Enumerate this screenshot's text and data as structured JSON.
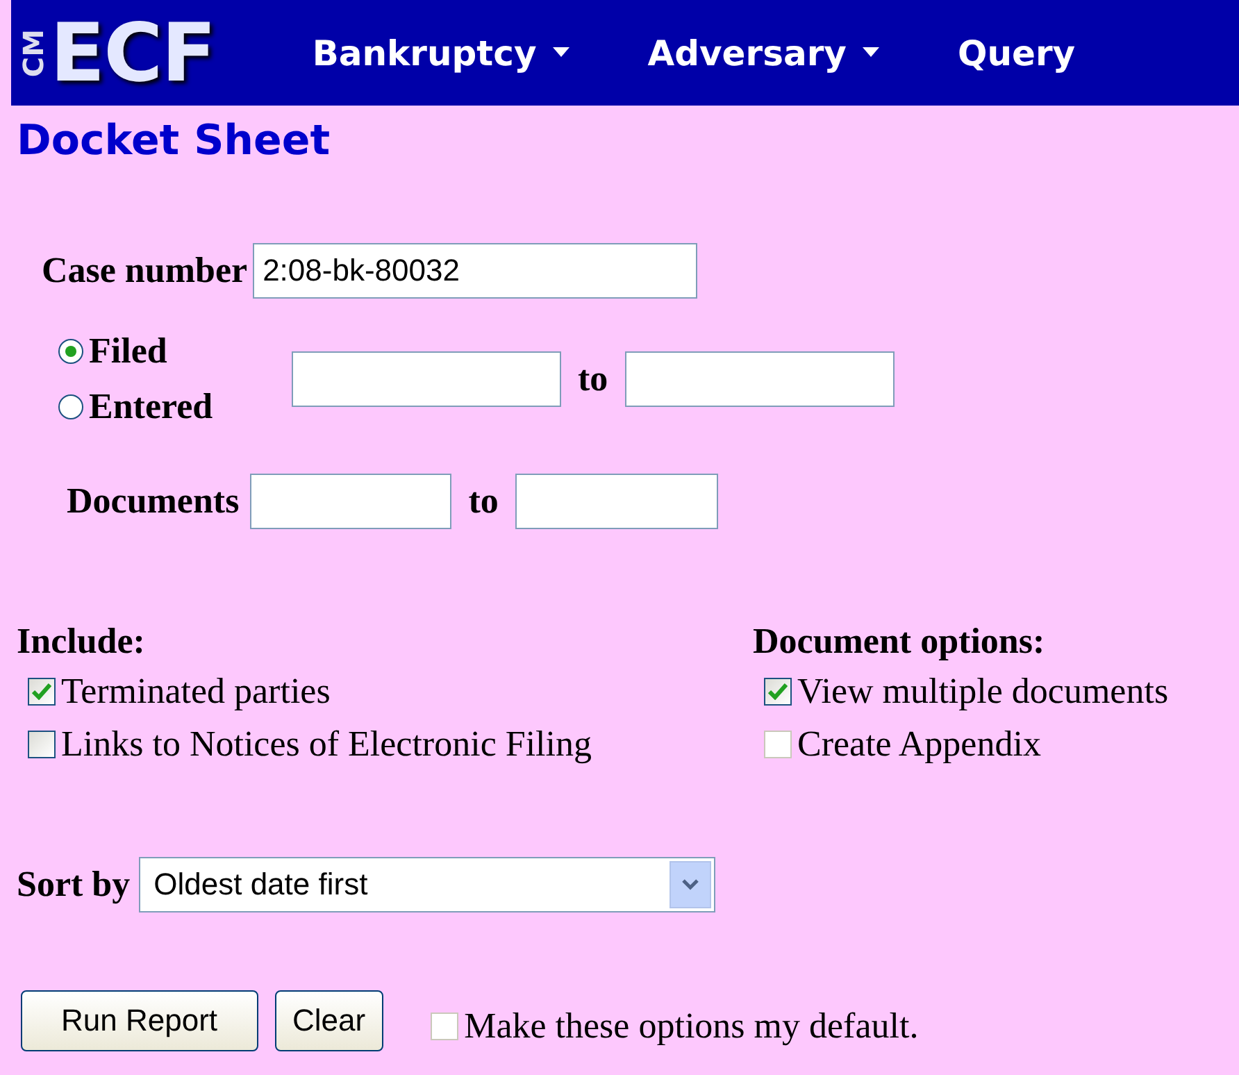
{
  "header": {
    "logo_small": "CM",
    "logo": "ECF",
    "menu": [
      {
        "label": "Bankruptcy",
        "dropdown": true
      },
      {
        "label": "Adversary",
        "dropdown": true
      },
      {
        "label": "Query",
        "dropdown": false
      }
    ]
  },
  "title": "Docket Sheet",
  "case_number": {
    "label": "Case number",
    "value": "2:08-bk-80032"
  },
  "date_type": [
    {
      "label": "Filed",
      "selected": true
    },
    {
      "label": "Entered",
      "selected": false
    }
  ],
  "date_range_separator": "to",
  "documents": {
    "label": "Documents",
    "separator": "to"
  },
  "include": {
    "heading": "Include:",
    "options": [
      {
        "label": "Terminated parties",
        "checked": true,
        "disabled": false
      },
      {
        "label": "Links to Notices of Electronic Filing",
        "checked": false,
        "disabled": false
      }
    ]
  },
  "document_options": {
    "heading": "Document options:",
    "options": [
      {
        "label": "View multiple documents",
        "checked": true,
        "disabled": false
      },
      {
        "label": "Create Appendix",
        "checked": false,
        "disabled": true
      }
    ]
  },
  "sort": {
    "label": "Sort by",
    "value": "Oldest date first"
  },
  "buttons": [
    "Run Report",
    "Clear"
  ],
  "default_option": {
    "label": "Make these options my default.",
    "checked": false,
    "disabled": true
  }
}
